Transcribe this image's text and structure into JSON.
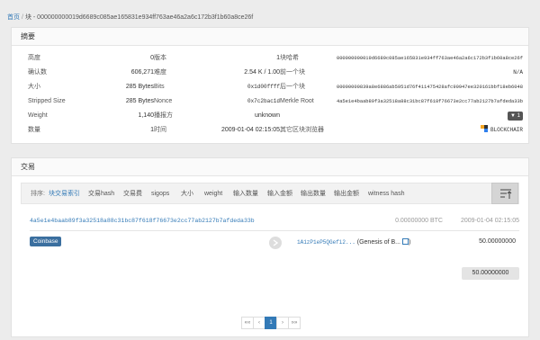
{
  "breadcrumb": {
    "home": "首页",
    "separator": "/",
    "current": "块 - 000000000019d6689c085ae165831e934ff763ae46a2a6c172b3f1b60a8ce26f"
  },
  "summary": {
    "title": "摘要",
    "col1": [
      {
        "k": "高度",
        "v": "0"
      },
      {
        "k": "确认数",
        "v": "606,271"
      },
      {
        "k": "大小",
        "v": "285 Bytes"
      },
      {
        "k": "Stripped Size",
        "v": "285 Bytes"
      },
      {
        "k": "Weight",
        "v": "1,140"
      },
      {
        "k": "数量",
        "v": "1"
      }
    ],
    "col2": [
      {
        "k": "版本",
        "v": "1"
      },
      {
        "k": "难度",
        "v": "2.54 K / 1.00"
      },
      {
        "k": "Bits",
        "v": "0x1d00ffff"
      },
      {
        "k": "Nonce",
        "v": "0x7c2bac1d"
      },
      {
        "k": "播报方",
        "v": "unknown"
      },
      {
        "k": "时间",
        "v": "2009-01-04 02:15:05"
      }
    ],
    "col3": [
      {
        "k": "块哈希",
        "v": "000000000019d6689c085ae165831e934ff763ae46a2a6c172b3f1b60a8ce26f"
      },
      {
        "k": "前一个块",
        "v": "N/A"
      },
      {
        "k": "后一个块",
        "v": "00000000839a8e6886ab5951d76f411475428afc90947ee320161bbf18eb6048"
      },
      {
        "k": "Merkle Root",
        "v": "4a5e1e4baab89f3a32518a88c31bc87f618f76673e2cc77ab2127b7afdeda33b"
      },
      {
        "k": "",
        "v": "1"
      },
      {
        "k": "其它区块浏览器",
        "v": "BLOCKCHAIR"
      }
    ]
  },
  "transactions": {
    "title": "交易",
    "sort_label": "排序:",
    "sort_options": [
      "块交易索引",
      "交易hash",
      "交易费",
      "sigops",
      "大小",
      "weight",
      "输入数量",
      "输入金额",
      "输出数量",
      "输出金额",
      "witness hash"
    ],
    "tx": {
      "hash": "4a5e1e4baab89f3a32518a88c31bc87f618f76673e2cc77ab2127b7afdeda33b",
      "fee": "0.00000000 BTC",
      "time": "2009-01-04 02:15:05",
      "input": "Coinbase",
      "output_address": "1A1zP1eP5QGefi2...",
      "output_note": "(Genesis of B...",
      "output_close": ")",
      "output_amount": "50.00000000",
      "total": "50.00000000"
    },
    "pager": [
      "««",
      "‹",
      "1",
      "›",
      "»»"
    ]
  },
  "colors": {
    "link": "#337ab7",
    "coinbase": "#3b6f9f"
  }
}
